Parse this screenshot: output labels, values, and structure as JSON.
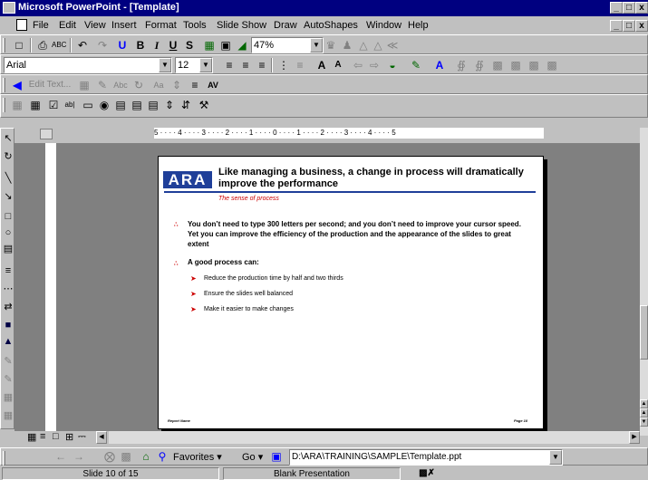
{
  "window": {
    "title": "Microsoft PowerPoint - [Template]",
    "controls": [
      "_",
      "□",
      "x"
    ]
  },
  "menubar": {
    "items": [
      "File",
      "Edit",
      "View",
      "Insert",
      "Format",
      "Tools",
      "Slide Show",
      "Draw",
      "AutoShapes",
      "Window",
      "Help"
    ]
  },
  "standard_toolbar": {
    "zoom": "47%"
  },
  "formatting_toolbar": {
    "font": "Arial",
    "font_size": "12"
  },
  "text_toolbar": {
    "edit_text": "Edit Text..."
  },
  "ruler": {
    "text": "5 · · · · 4 · · · · 3 · · · · 2 · · · · 1 · · · · 0 · · · · 1 · · · · 2 · · · · 3 · · · · 4 · · · · 5"
  },
  "slide": {
    "logo": "ARA",
    "title": "Like managing a business, a change in process will dramatically improve the performance",
    "subtitle": "The sense of process",
    "bullets": [
      {
        "text": "You don’t need to type 300 letters per second; and you don’t need to improve your cursor speed. Yet you can improve the efficiency of the production and the appearance of the slides to great extent",
        "sub": []
      },
      {
        "text": "A good process can:",
        "sub": [
          "Reduce the production time by half and two thirds",
          "Ensure the slides well balanced",
          "Make it easier to make changes"
        ]
      }
    ],
    "footer_left": "Report Name",
    "footer_right": "Page 10"
  },
  "webbar": {
    "favorites": "Favorites",
    "go": "Go",
    "address": "D:\\ARA\\TRAINING\\SAMPLE\\Template.ppt"
  },
  "statusbar": {
    "slide": "Slide 10 of 15",
    "design": "Blank Presentation"
  },
  "colors": {
    "titlebar": "#000080",
    "accent_red": "#cc0000",
    "logo_blue": "#1f3f99"
  }
}
